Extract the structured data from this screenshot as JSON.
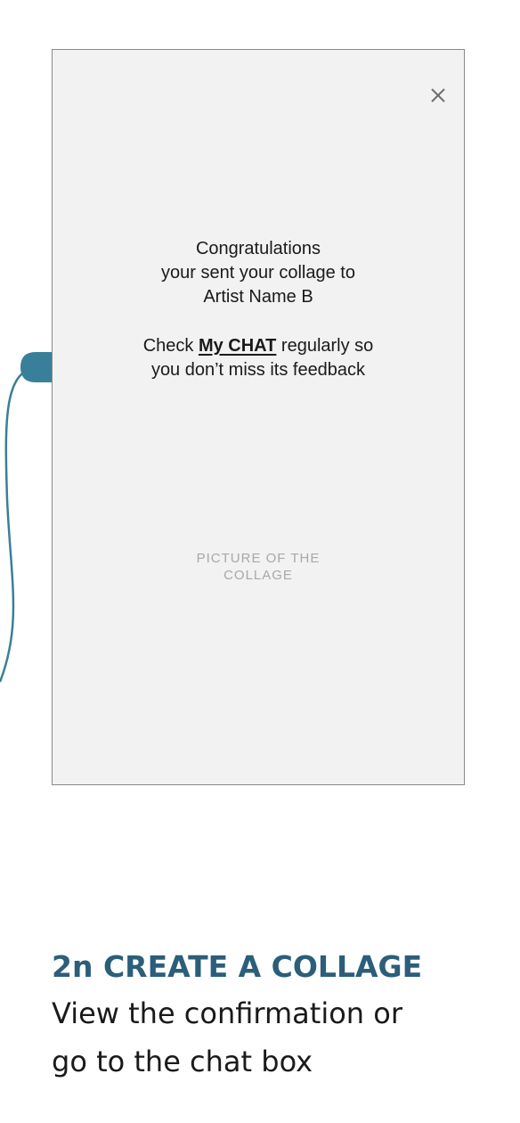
{
  "colors": {
    "accent": "#3a7f99",
    "caption_title": "#2b5e7a",
    "screen_background": "#f2f2f2",
    "placeholder_text": "#a8a8a8"
  },
  "screen": {
    "close_icon": "close-icon",
    "message": {
      "line1": "Congratulations",
      "line2": "your sent your collage to",
      "line3": "Artist Name B",
      "check_prefix": "Check",
      "chat_link": "My CHAT",
      "check_suffix": "regularly so",
      "line5": "you don’t miss its feedback"
    },
    "placeholder": {
      "line1": "PICTURE OF THE",
      "line2": "COLLAGE"
    }
  },
  "caption": {
    "title": "2n CREATE A COLLAGE",
    "desc_line1": "View the confirmation or",
    "desc_line2": "go to the chat box"
  }
}
